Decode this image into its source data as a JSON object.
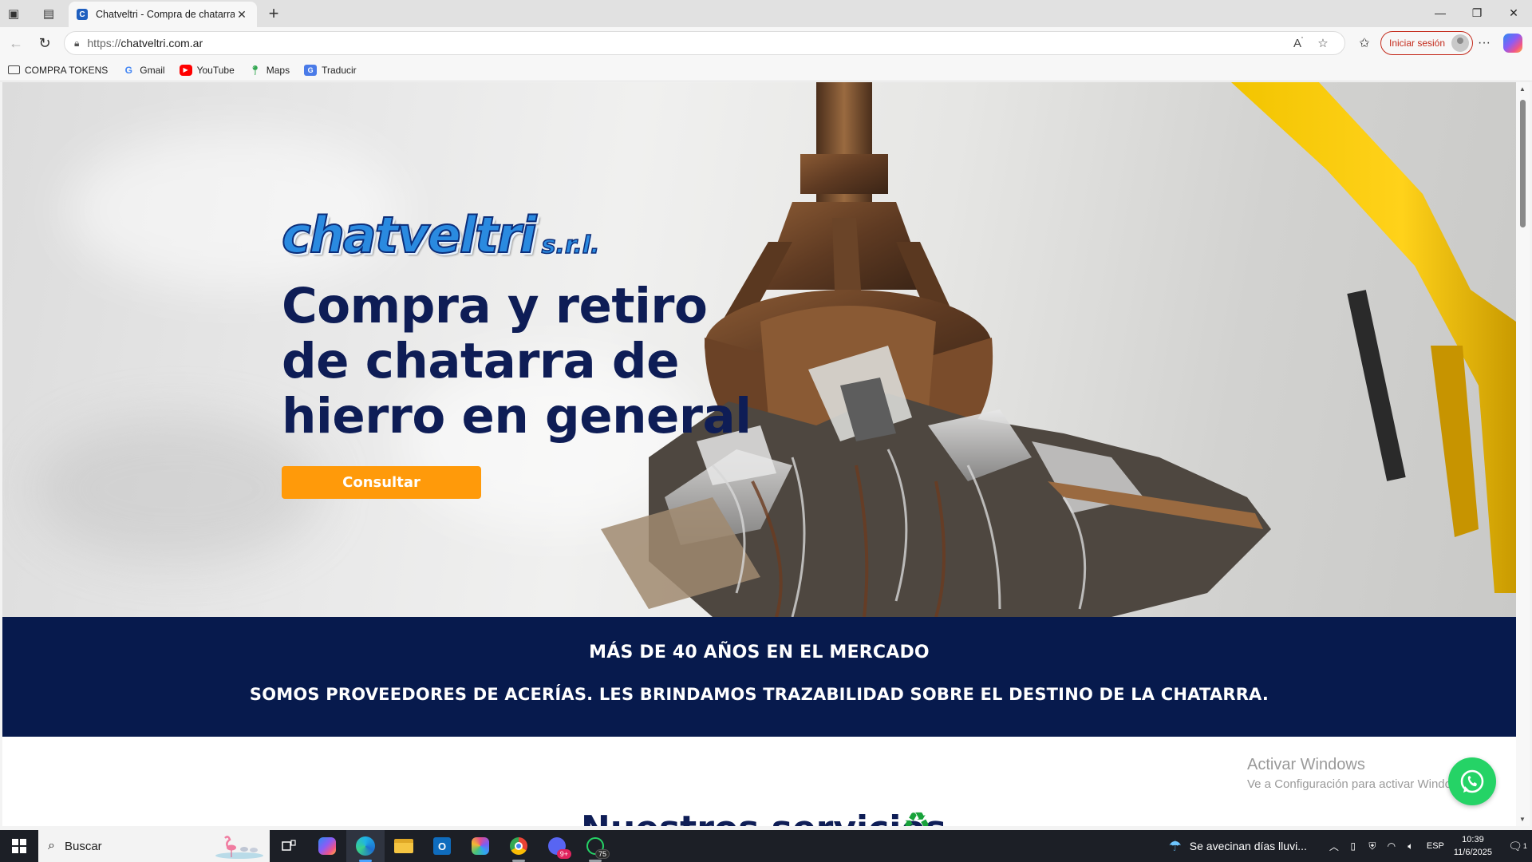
{
  "browser": {
    "tab_title": "Chatveltri - Compra de chatarra a",
    "url_proto": "https://",
    "url_host": "chatveltri.com.ar",
    "signin_label": "Iniciar sesión",
    "bookmarks": [
      {
        "label": "COMPRA TOKENS",
        "icon": "folder-icon"
      },
      {
        "label": "Gmail",
        "icon": "google-icon"
      },
      {
        "label": "YouTube",
        "icon": "youtube-icon"
      },
      {
        "label": "Maps",
        "icon": "maps-icon"
      },
      {
        "label": "Traducir",
        "icon": "translate-icon"
      }
    ]
  },
  "page": {
    "logo_text": "chatveltri",
    "logo_suffix": "s.r.l.",
    "headline": "Compra y retiro de chatarra de hierro en general",
    "cta_label": "Consultar",
    "banner_line1": "MÁS DE 40 AÑOS EN EL MERCADO",
    "banner_line2": "SOMOS PROVEEDORES DE ACERÍAS. LES BRINDAMOS TRAZABILIDAD SOBRE EL DESTINO DE LA CHATARRA.",
    "services_title": "Nuestros servicios",
    "colors": {
      "navy": "#0e1d56",
      "banner": "#071a4d",
      "cta": "#ff9a0a",
      "whatsapp": "#25d366"
    }
  },
  "windows_watermark": {
    "line1": "Activar Windows",
    "line2": "Ve a Configuración para activar Windows."
  },
  "taskbar": {
    "search_placeholder": "Buscar",
    "weather_text": "Se avecinan días lluvi...",
    "language": "ESP",
    "time": "10:39",
    "date": "11/6/2025",
    "whatsapp_badge": "75",
    "discord_badge": "9+",
    "notif_count": "1"
  }
}
